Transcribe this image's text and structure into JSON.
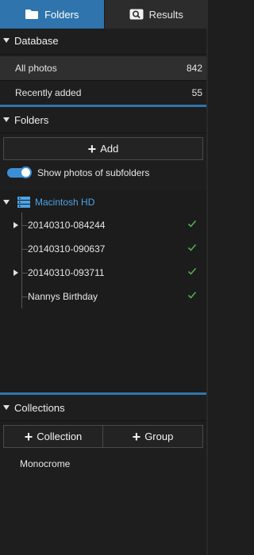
{
  "tabs": [
    {
      "label": "Folders",
      "icon": "folder-icon",
      "active": true
    },
    {
      "label": "Results",
      "icon": "search-icon",
      "active": false
    }
  ],
  "database": {
    "title": "Database",
    "items": [
      {
        "label": "All photos",
        "count": "842"
      },
      {
        "label": "Recently added",
        "count": "55"
      }
    ]
  },
  "folders": {
    "title": "Folders",
    "add_label": "Add",
    "toggle_label": "Show photos of subfolders",
    "toggle_on": true,
    "volume": {
      "label": "Macintosh HD",
      "icon": "hard-drive-icon"
    },
    "items": [
      {
        "label": "20140310-084244",
        "expandable": true
      },
      {
        "label": "20140310-090637",
        "expandable": false
      },
      {
        "label": "20140310-093711",
        "expandable": true
      },
      {
        "label": "Nannys Birthday",
        "expandable": false
      }
    ]
  },
  "collections": {
    "title": "Collections",
    "add_collection_label": "Collection",
    "add_group_label": "Group",
    "items": [
      {
        "label": "Monocrome"
      }
    ]
  },
  "colors": {
    "accent": "#2f74ad",
    "volume": "#4da3e6",
    "check": "#4caf50",
    "background": "#1e1e1e"
  }
}
